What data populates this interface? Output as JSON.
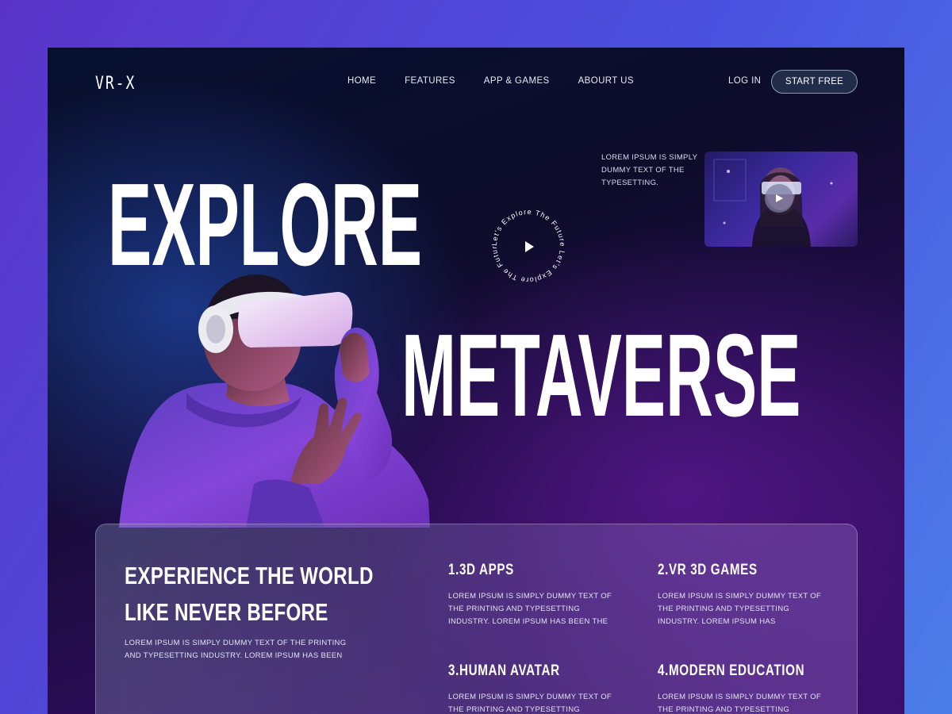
{
  "brand": {
    "logo": "VR-X"
  },
  "nav": {
    "items": [
      "HOME",
      "FEATURES",
      "APP & GAMES",
      "ABOURT US"
    ],
    "login": "LOG IN",
    "start_free": "START FREE"
  },
  "hero": {
    "title_line_1": "EXPLORE",
    "title_line_2": "METAVERSE",
    "badge_text": "Let's Explore The Future Let's Explore The Future",
    "note": "LOREM IPSUM IS SIMPLY DUMMY TEXT OF THE TYPESETTING."
  },
  "panel": {
    "title": "EXPERIENCE THE WORLD LIKE NEVER BEFORE",
    "description": "LOREM IPSUM IS SIMPLY DUMMY TEXT OF THE PRINTING AND TYPESETTING INDUSTRY. LOREM IPSUM HAS BEEN",
    "features": [
      {
        "title": "1.3D APPS",
        "text": "LOREM IPSUM IS SIMPLY DUMMY TEXT OF THE PRINTING AND TYPESETTING INDUSTRY. LOREM IPSUM HAS BEEN THE"
      },
      {
        "title": "2.VR 3D GAMES",
        "text": "LOREM IPSUM IS SIMPLY DUMMY TEXT OF THE PRINTING AND TYPESETTING INDUSTRY. LOREM IPSUM HAS"
      },
      {
        "title": "3.HUMAN AVATAR",
        "text": "LOREM IPSUM IS SIMPLY DUMMY TEXT OF THE PRINTING AND TYPESETTING INDUSTRY."
      },
      {
        "title": "4.MODERN EDUCATION",
        "text": "LOREM IPSUM IS SIMPLY DUMMY TEXT OF THE PRINTING AND TYPESETTING INDUSTRY."
      }
    ]
  },
  "icons": {
    "badge_play": "play-icon",
    "video_play": "play-icon"
  },
  "colors": {
    "background_outer": "#4a52e0",
    "hero_dark": "#0d0c2a",
    "hero_purple": "#3b0f6e",
    "button_bg": "#23304e",
    "hoodie_purple": "#7a3fd6"
  }
}
